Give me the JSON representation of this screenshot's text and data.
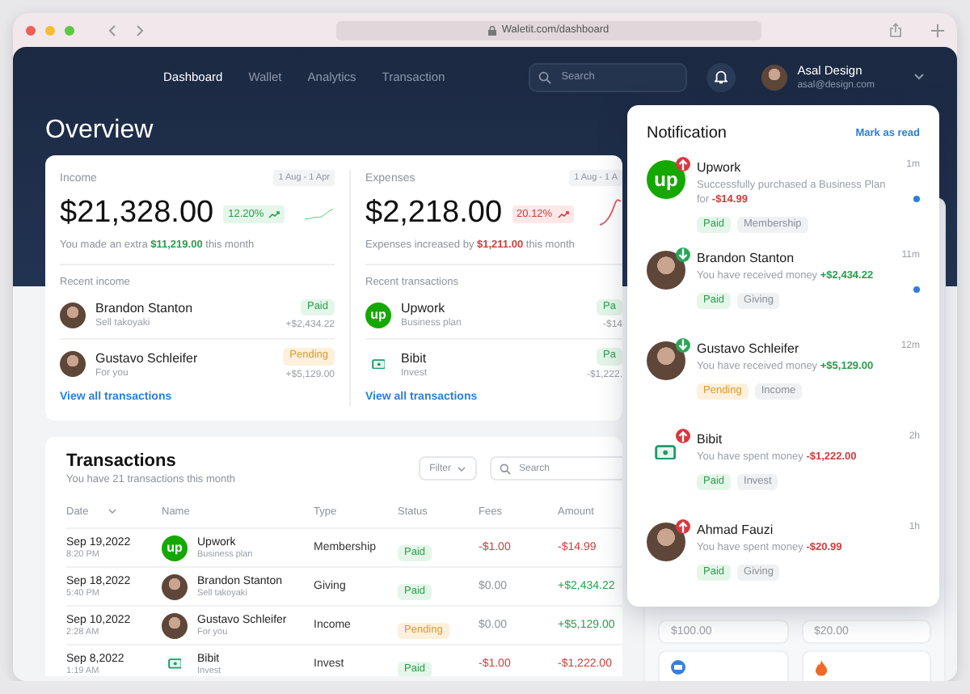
{
  "browser": {
    "url": "Waletit.com/dashboard"
  },
  "nav": {
    "links": [
      {
        "label": "Dashboard",
        "selected": true
      },
      {
        "label": "Wallet",
        "selected": false
      },
      {
        "label": "Analytics",
        "selected": false
      },
      {
        "label": "Transaction",
        "selected": false
      }
    ],
    "search": {
      "placeholder": "Search"
    },
    "user": {
      "name": "Asal Design",
      "email": "asal@design.com"
    }
  },
  "title": "Overview",
  "summary_cards": [
    {
      "kind": "income",
      "label": "Income",
      "range": "1 Aug - 1 Apr",
      "amount": "$21,328.00",
      "change": "12.20%",
      "note": "You made an extra **$11,219.00** this month",
      "recent_title": "Recent income",
      "items": [
        {
          "kind": "person",
          "name": "Brandon Stanton",
          "sub": "Sell takoyaki",
          "status": {
            "label": "Paid",
            "kind": "paid"
          },
          "amount": "+$2,434.22"
        },
        {
          "kind": "person",
          "name": "Gustavo Schleifer",
          "sub": "For you",
          "status": {
            "label": "Pending",
            "kind": "pending"
          },
          "amount": "+$5,129.00"
        }
      ],
      "link": "View all transactions"
    },
    {
      "kind": "expense",
      "label": "Expenses",
      "range": "1 Aug - 1 A",
      "amount": "$2,218.00",
      "change": "20.12%",
      "note": "Expenses increased by **$1,211.00** this month",
      "recent_title": "Recent transactions",
      "items": [
        {
          "kind": "upwork",
          "logo_text": "up",
          "name": "Upwork",
          "sub": "Business plan",
          "status": {
            "label": "Pa",
            "kind": "paid"
          },
          "amount": "-$14"
        },
        {
          "kind": "bibit",
          "name": "Bibit",
          "sub": "Invest",
          "status": {
            "label": "Pa",
            "kind": "paid"
          },
          "amount": "-$1,222."
        }
      ],
      "link": "View all transactions"
    }
  ],
  "transactions": {
    "title": "Transactions",
    "subtitle": "You have 21 transactions this month",
    "filter": "Filter",
    "search": {
      "placeholder": "Search"
    },
    "columns": [
      "Date",
      "Name",
      "Type",
      "Status",
      "Fees",
      "Amount"
    ],
    "rows": [
      {
        "kind": "upwork",
        "logo_text": "up",
        "date": "Sep 19,2022",
        "time": "8:20 PM",
        "name": "Upwork",
        "sub": "Business plan",
        "type": "Membership",
        "status": {
          "label": "Paid",
          "kind": "paid"
        },
        "fees": {
          "text": "-$1.00",
          "kind": "negative"
        },
        "amount": {
          "text": "-$14.99",
          "kind": "negative"
        }
      },
      {
        "kind": "person",
        "date": "Sep 18,2022",
        "time": "5:40 PM",
        "name": "Brandon Stanton",
        "sub": "Sell takoyaki",
        "type": "Giving",
        "status": {
          "label": "Paid",
          "kind": "paid"
        },
        "fees": {
          "text": "$0.00",
          "kind": "neutral"
        },
        "amount": {
          "text": "+$2,434.22",
          "kind": "positive"
        }
      },
      {
        "kind": "person",
        "date": "Sep 10,2022",
        "time": "2:28 AM",
        "name": "Gustavo Schleifer",
        "sub": "For you",
        "type": "Income",
        "status": {
          "label": "Pending",
          "kind": "pending"
        },
        "fees": {
          "text": "$0.00",
          "kind": "neutral"
        },
        "amount": {
          "text": "+$5,129.00",
          "kind": "positive"
        }
      },
      {
        "kind": "bibit",
        "date": "Sep 8,2022",
        "time": "1:19 AM",
        "name": "Bibit",
        "sub": "Invest",
        "type": "Invest",
        "status": {
          "label": "Paid",
          "kind": "paid"
        },
        "fees": {
          "text": "-$1.00",
          "kind": "negative"
        },
        "amount": {
          "text": "-$1,222.00",
          "kind": "negative"
        }
      }
    ]
  },
  "wallet_cards": [
    {
      "amount": "$100.00"
    },
    {
      "amount": "$20.00"
    }
  ],
  "notifications": {
    "title": "Notification",
    "action": "Mark as read",
    "items": [
      {
        "kind": "upwork",
        "logo_text": "up",
        "outgoing": true,
        "name": "Upwork",
        "text": "Successfully purchased a Business Plan for **-$14.99**",
        "time": "1m",
        "unread": true,
        "tags": [
          {
            "label": "Paid",
            "kind": "paid"
          },
          {
            "label": "Membership",
            "kind": "category"
          }
        ]
      },
      {
        "kind": "person",
        "outgoing": false,
        "name": "Brandon Stanton",
        "text": "You have received money **+$2,434.22**",
        "time": "11m",
        "unread": true,
        "tags": [
          {
            "label": "Paid",
            "kind": "paid"
          },
          {
            "label": "Giving",
            "kind": "category"
          }
        ]
      },
      {
        "kind": "person",
        "outgoing": false,
        "name": "Gustavo Schleifer",
        "text": "You have received money **+$5,129.00**",
        "time": "12m",
        "unread": false,
        "tags": [
          {
            "label": "Pending",
            "kind": "pending"
          },
          {
            "label": "Income",
            "kind": "category"
          }
        ]
      },
      {
        "kind": "bibit",
        "outgoing": true,
        "name": "Bibit",
        "text": "You have spent money **-$1,222.00**",
        "time": "2h",
        "unread": false,
        "tags": [
          {
            "label": "Paid",
            "kind": "paid"
          },
          {
            "label": "Invest",
            "kind": "category"
          }
        ]
      },
      {
        "kind": "person",
        "outgoing": true,
        "name": "Ahmad Fauzi",
        "text": "You have spent money **-$20.99**",
        "time": "1h",
        "unread": false,
        "tags": [
          {
            "label": "Paid",
            "kind": "paid"
          },
          {
            "label": "Giving",
            "kind": "category"
          }
        ]
      }
    ]
  }
}
